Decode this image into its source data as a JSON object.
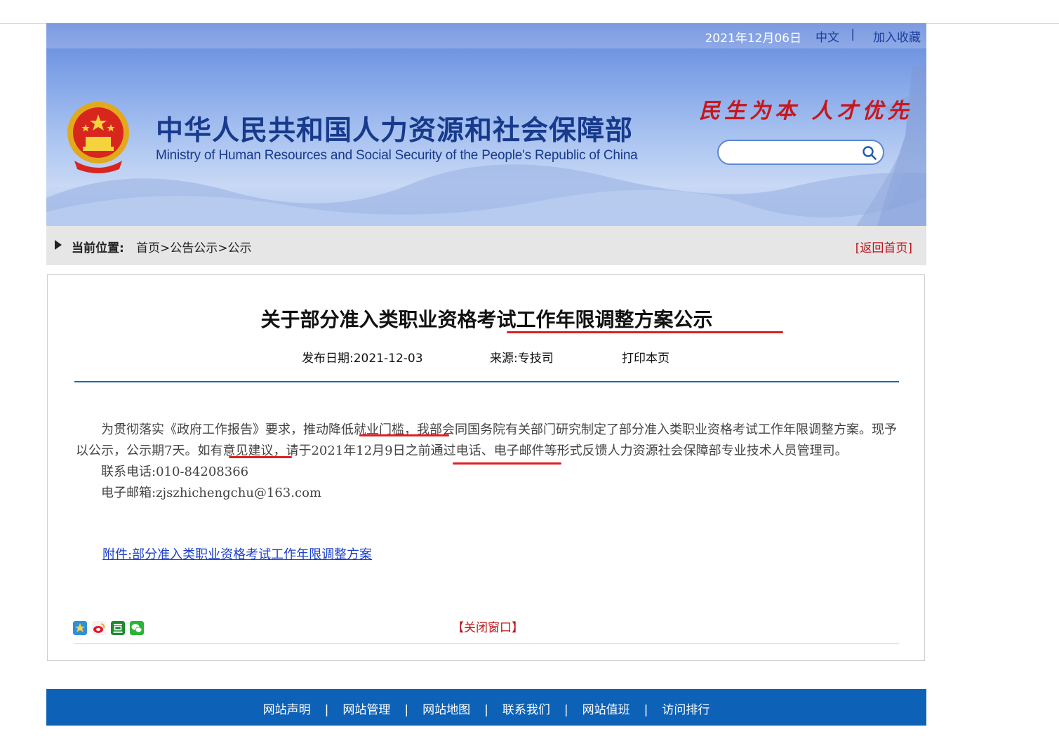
{
  "header": {
    "date": "2021年12月06日",
    "lang": "中文",
    "separator": "|",
    "favorite": "加入收藏",
    "title_cn": "中华人民共和国人力资源和社会保障部",
    "title_en": "Ministry of Human Resources and Social Security of the People's Republic of China",
    "slogan": "民生为本 人才优先",
    "search_placeholder": ""
  },
  "breadcrumb": {
    "label": "当前位置:",
    "items": [
      "首页",
      "公告公示",
      "公示"
    ],
    "sep": ">",
    "back": "[返回首页]"
  },
  "article": {
    "title": "关于部分准入类职业资格考试工作年限调整方案公示",
    "publish_date": "发布日期:2021-12-03",
    "source": "来源:专技司",
    "print": "打印本页",
    "paragraph": "为贯彻落实《政府工作报告》要求，推动降低就业门槛，我部会同国务院有关部门研究制定了部分准入类职业资格考试工作年限调整方案。现予以公示，公示期7天。如有意见建议，请于2021年12月9日之前通过电话、电子邮件等形式反馈人力资源社会保障部专业技术人员管理司。",
    "phone": "联系电话:010-84208366",
    "email": "电子邮箱:zjszhichengchu@163.com",
    "attachment": "附件:部分准入类职业资格考试工作年限调整方案",
    "close": "【关闭窗口】"
  },
  "footer": {
    "links": [
      "网站声明",
      "网站管理",
      "网站地图",
      "联系我们",
      "网站值班",
      "访问排行"
    ],
    "sep": "|"
  },
  "colors": {
    "brand_blue": "#173a8c",
    "footer_blue": "#0d62b7",
    "accent_red": "#c0141b",
    "annotation_red": "#e02020"
  }
}
